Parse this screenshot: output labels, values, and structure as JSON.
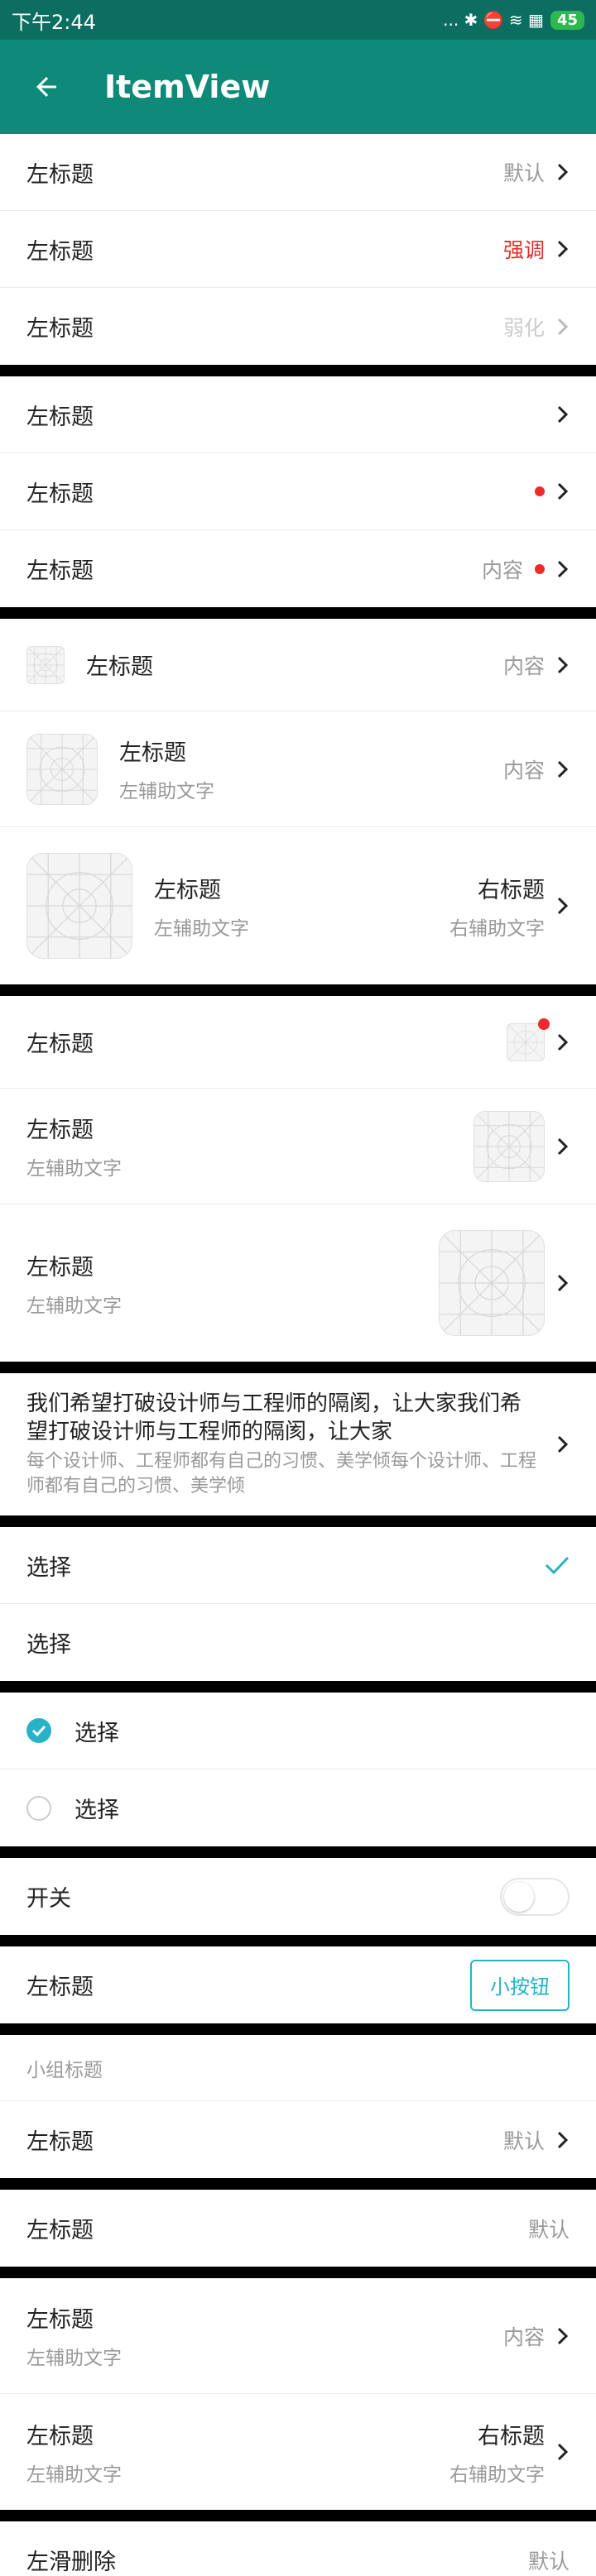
{
  "status_bar": {
    "time": "下午2:44",
    "icons": "... ✱ ⛔ ≋ ▦",
    "battery": "45"
  },
  "app_bar": {
    "title": "ItemView"
  },
  "group1": [
    {
      "title": "左标题",
      "value": "默认"
    },
    {
      "title": "左标题",
      "value": "强调"
    },
    {
      "title": "左标题",
      "value": "弱化"
    }
  ],
  "group2": [
    {
      "title": "左标题"
    },
    {
      "title": "左标题"
    },
    {
      "title": "左标题",
      "value": "内容"
    }
  ],
  "group3": [
    {
      "title": "左标题",
      "value": "内容"
    },
    {
      "title": "左标题",
      "subtitle": "左辅助文字",
      "value": "内容"
    },
    {
      "title": "左标题",
      "subtitle": "左辅助文字",
      "right_title": "右标题",
      "right_subtitle": "右辅助文字"
    }
  ],
  "group4": [
    {
      "title": "左标题"
    },
    {
      "title": "左标题",
      "subtitle": "左辅助文字"
    },
    {
      "title": "左标题",
      "subtitle": "左辅助文字"
    }
  ],
  "group5": {
    "title": "我们希望打破设计师与工程师的隔阂，让大家我们希望打破设计师与工程师的隔阂，让大家",
    "subtitle": "每个设计师、工程师都有自己的习惯、美学倾每个设计师、工程师都有自己的习惯、美学倾"
  },
  "group6": [
    {
      "label": "选择",
      "checked": true
    },
    {
      "label": "选择",
      "checked": false
    }
  ],
  "group7": [
    {
      "label": "选择",
      "checked": true
    },
    {
      "label": "选择",
      "checked": false
    }
  ],
  "group8": {
    "label": "开关",
    "on": false
  },
  "group9": {
    "title": "左标题",
    "button": "小按钮"
  },
  "group10": {
    "header": "小组标题",
    "title": "左标题",
    "value": "默认"
  },
  "group11": {
    "title": "左标题",
    "value": "默认"
  },
  "group12": [
    {
      "title": "左标题",
      "subtitle": "左辅助文字",
      "value": "内容"
    },
    {
      "title": "左标题",
      "subtitle": "左辅助文字",
      "right_title": "右标题",
      "right_subtitle": "右辅助文字"
    }
  ],
  "group13": {
    "title": "左滑删除",
    "value": "默认"
  },
  "colors": {
    "appbar": "#0f8a78",
    "statusbar": "#0b6e61",
    "accent": "#28b2c7",
    "red": "#e0302f"
  }
}
